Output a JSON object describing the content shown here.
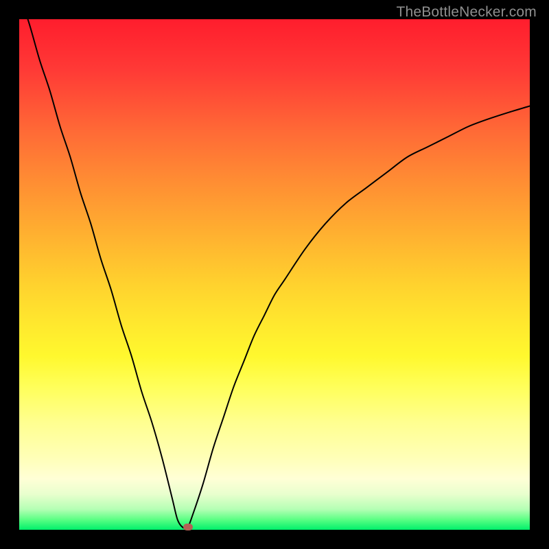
{
  "watermark": "TheBottleNecker.com",
  "chart_data": {
    "type": "line",
    "title": "",
    "xlabel": "",
    "ylabel": "",
    "xlim": [
      0,
      100
    ],
    "ylim": [
      0,
      100
    ],
    "grid": false,
    "series": [
      {
        "name": "bottleneck-curve",
        "x": [
          0,
          2,
          4,
          6,
          8,
          10,
          12,
          14,
          16,
          18,
          20,
          22,
          24,
          26,
          28,
          30,
          31,
          32,
          33,
          34,
          36,
          38,
          40,
          42,
          44,
          46,
          48,
          50,
          52,
          56,
          60,
          64,
          68,
          72,
          76,
          80,
          84,
          88,
          92,
          96,
          100
        ],
        "values": [
          105,
          99,
          92,
          86,
          79,
          73,
          66,
          60,
          53,
          47,
          40,
          34,
          27,
          21,
          14,
          6,
          2,
          0.5,
          0.5,
          3,
          9,
          16,
          22,
          28,
          33,
          38,
          42,
          46,
          49,
          55,
          60,
          64,
          67,
          70,
          73,
          75,
          77,
          79,
          80.5,
          81.8,
          83
        ]
      }
    ],
    "annotations": [
      {
        "name": "optimal-marker",
        "x": 33,
        "y": 0.5
      }
    ],
    "background": "heatmap-gradient red-yellow-green vertical"
  }
}
